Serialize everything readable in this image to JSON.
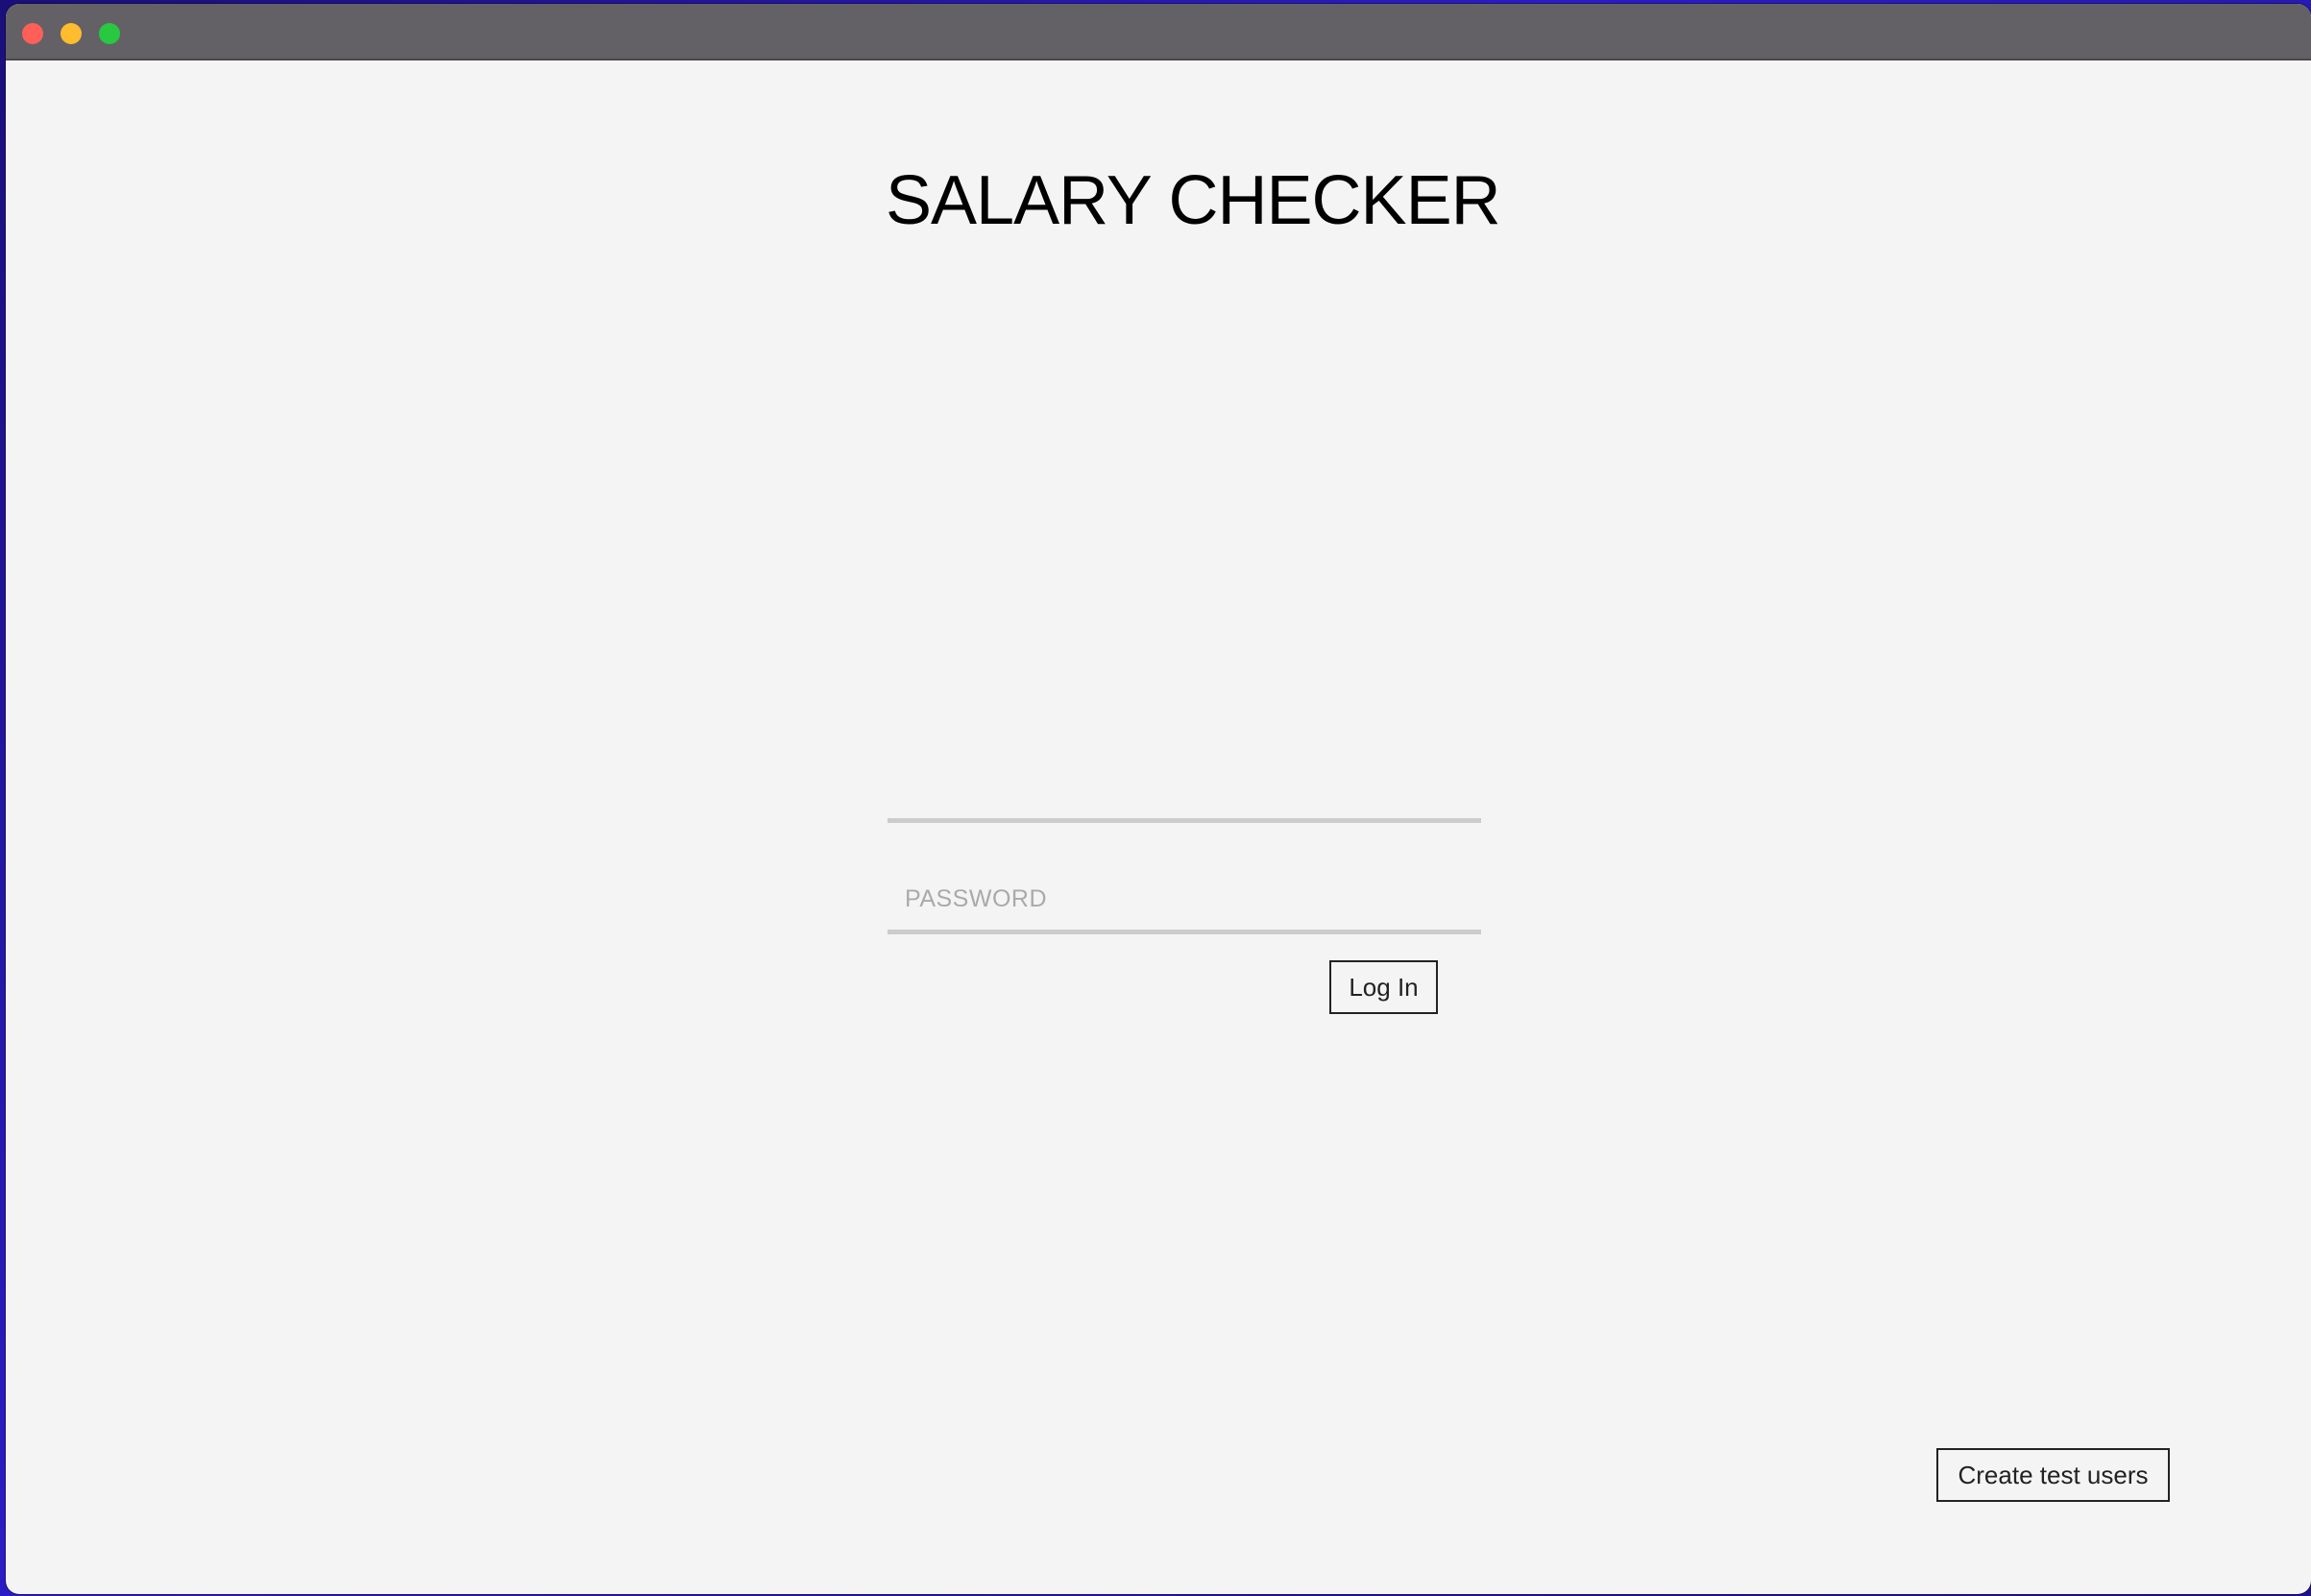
{
  "window": {
    "controls": [
      "close",
      "minimize",
      "maximize"
    ]
  },
  "app": {
    "title": "SALARY CHECKER"
  },
  "login_form": {
    "username": {
      "value": "",
      "placeholder": ""
    },
    "password": {
      "value": "",
      "placeholder": "PASSWORD"
    },
    "login_label": "Log In"
  },
  "footer": {
    "create_test_users_label": "Create test users"
  },
  "colors": {
    "titlebar": "#636166",
    "window_background": "#f4f4f4",
    "close": "#fe5f57",
    "minimize": "#febc2e",
    "maximize": "#28c840",
    "field_underline": "#cccccc"
  }
}
